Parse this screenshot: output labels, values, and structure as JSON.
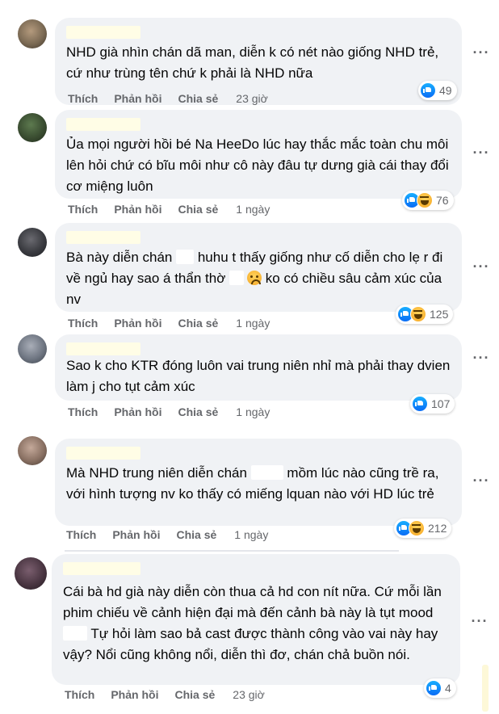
{
  "action_labels": {
    "like": "Thích",
    "reply": "Phản hồi",
    "share": "Chia sẻ"
  },
  "comments": [
    {
      "text_parts": [
        "NHD già nhìn chán dã man, diễn k có nét nào giống NHD trẻ, cứ như trùng tên chứ k phải là NHD nữa"
      ],
      "time": "23 giờ",
      "reactions": [
        "like-icon"
      ],
      "reaction_count": "49"
    },
    {
      "text_parts": [
        "Ủa mọi người hồi bé Na HeeDo lúc hay thắc mắc toàn chu môi lên hỏi chứ có bĩu môi như cô này đâu tự dưng già cái thay đổi cơ miệng luôn"
      ],
      "time": "1 ngày",
      "reactions": [
        "like-icon",
        "haha-icon"
      ],
      "reaction_count": "76"
    },
    {
      "text_parts": [
        "Bà này diễn chán ",
        " huhu t thấy giống như cố diễn cho lẹ r đi về ngủ hay sao á thẩn thờ ",
        " ko có chiều sâu cảm xúc của nv"
      ],
      "time": "1 ngày",
      "reactions": [
        "like-icon",
        "haha-icon"
      ],
      "reaction_count": "125"
    },
    {
      "text_parts": [
        "Sao k cho KTR đóng luôn vai trung niên nhỉ mà phải thay dvien làm j cho tụt cảm xúc"
      ],
      "time": "1 ngày",
      "reactions": [
        "like-icon"
      ],
      "reaction_count": "107"
    },
    {
      "text_parts": [
        "Mà NHD trung niên diễn chán ",
        " mồm lúc nào cũng trề ra, với hình tượng nv ko thấy có miếng lquan nào với HD lúc trẻ"
      ],
      "time": "1 ngày",
      "reactions": [
        "like-icon",
        "haha-icon"
      ],
      "reaction_count": "212"
    },
    {
      "text_parts": [
        "Cái bà hd già này diễn còn thua cả hd con nít nữa. Cứ mỗi lần phim chiếu về cảnh hiện đại mà đến cảnh bà này là tụt mood ",
        " Tự hỏi làm sao bả cast được thành công vào vai này hay vậy? Nổi cũng không nổi, diễn thì đơ, chán chả buồn nói."
      ],
      "time": "23 giờ",
      "reactions": [
        "like-icon"
      ],
      "reaction_count": "4"
    }
  ]
}
